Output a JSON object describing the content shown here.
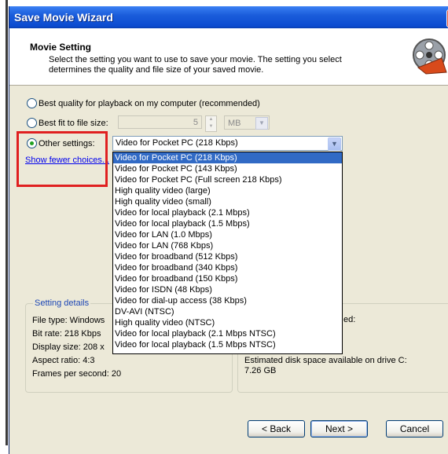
{
  "window": {
    "title": "Save Movie Wizard",
    "close_glyph": "✕"
  },
  "header": {
    "title": "Movie Setting",
    "description": "Select the setting you want to use to save your movie. The setting you select determines the quality and file size of your saved movie.",
    "icon": "film-reel-icon"
  },
  "options": {
    "best_quality_label": "Best quality for playback on my computer (recommended)",
    "best_fit_label": "Best fit to file size:",
    "best_fit_value": "5",
    "best_fit_unit": "MB",
    "other_settings_label": "Other settings:",
    "selected": "Other settings"
  },
  "settings_select": {
    "value": "Video for Pocket PC (218 Kbps)"
  },
  "show_fewer_link": "Show fewer choices...",
  "dropdown": {
    "selected_index": 0,
    "options": [
      "Video for Pocket PC (218 Kbps)",
      "Video for Pocket PC (143 Kbps)",
      "Video for Pocket PC (Full screen 218 Kbps)",
      "High quality video (large)",
      "High quality video (small)",
      "Video for local playback (2.1 Mbps)",
      "Video for local playback (1.5 Mbps)",
      "Video for LAN (1.0 Mbps)",
      "Video for LAN (768 Kbps)",
      "Video for broadband (512 Kbps)",
      "Video for broadband (340 Kbps)",
      "Video for broadband (150 Kbps)",
      "Video for ISDN (48 Kbps)",
      "Video for dial-up access (38 Kbps)",
      "DV-AVI (NTSC)",
      "High quality video (NTSC)",
      "Video for local playback (2.1 Mbps NTSC)",
      "Video for local playback (1.5 Mbps NTSC)"
    ]
  },
  "setting_details": {
    "title": "Setting details",
    "file_type": "File type: Windows",
    "bit_rate": "Bit rate: 218 Kbps",
    "display_size": "Display size: 208 x",
    "aspect_ratio": "Aspect ratio: 4:3",
    "frames_per_second": "Frames per second: 20"
  },
  "disk": {
    "partial_label": "ed:",
    "space_label": "Estimated disk space available on drive C:",
    "space_value": "7.26 GB"
  },
  "buttons": {
    "back": "< Back",
    "next": "Next >",
    "cancel": "Cancel"
  },
  "colors": {
    "selection": "#316ac5",
    "highlight_box": "#e02020",
    "link": "#0000ee"
  }
}
